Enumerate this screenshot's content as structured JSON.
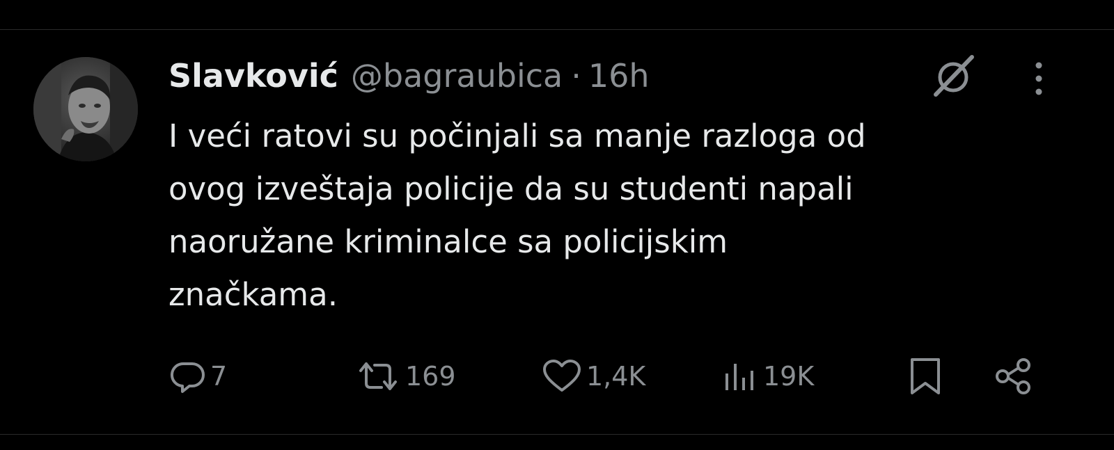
{
  "tweet": {
    "author_name": "Slavković",
    "handle": "@bagraubica",
    "separator": "·",
    "time": "16h",
    "text": "I veći ratovi su počinjali sa manje razloga od\novog izveštaja policije da su studenti napali\nnaoružane kriminalce sa policijskim\nznačkama."
  },
  "actions": {
    "reply_count": "7",
    "retweet_count": "169",
    "like_count": "1,4K",
    "views_count": "19K"
  },
  "icons": {
    "reply": "reply-icon",
    "retweet": "retweet-icon",
    "like": "heart-icon",
    "views": "views-icon",
    "bookmark": "bookmark-icon",
    "share": "share-icon",
    "grok": "grok-icon",
    "more": "more-icon"
  },
  "colors": {
    "background": "#000000",
    "text_primary": "#e7e9ea",
    "text_secondary": "#8b8f93"
  }
}
